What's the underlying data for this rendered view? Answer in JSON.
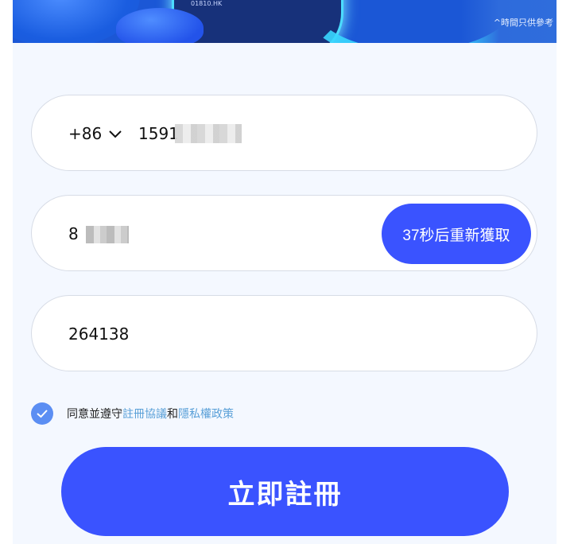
{
  "banner": {
    "ticker_text": "01810.HK",
    "disclaimer": "^時間只供參考"
  },
  "phone_field": {
    "country_code": "+86",
    "value": "1591"
  },
  "sms_field": {
    "value": "8",
    "resend_label": "37秒后重新獲取"
  },
  "invite_field": {
    "value": "264138"
  },
  "agreement": {
    "prefix": "同意並遵守",
    "terms_link": "註冊協議",
    "conjunction": "和",
    "privacy_link": "隱私權政策"
  },
  "submit": {
    "label": "立即註冊"
  },
  "colors": {
    "accent": "#3a53ff",
    "link": "#5aa0d8",
    "check": "#5b8ef3"
  },
  "icons": [
    "chevron-down-icon",
    "checkmark-icon"
  ]
}
